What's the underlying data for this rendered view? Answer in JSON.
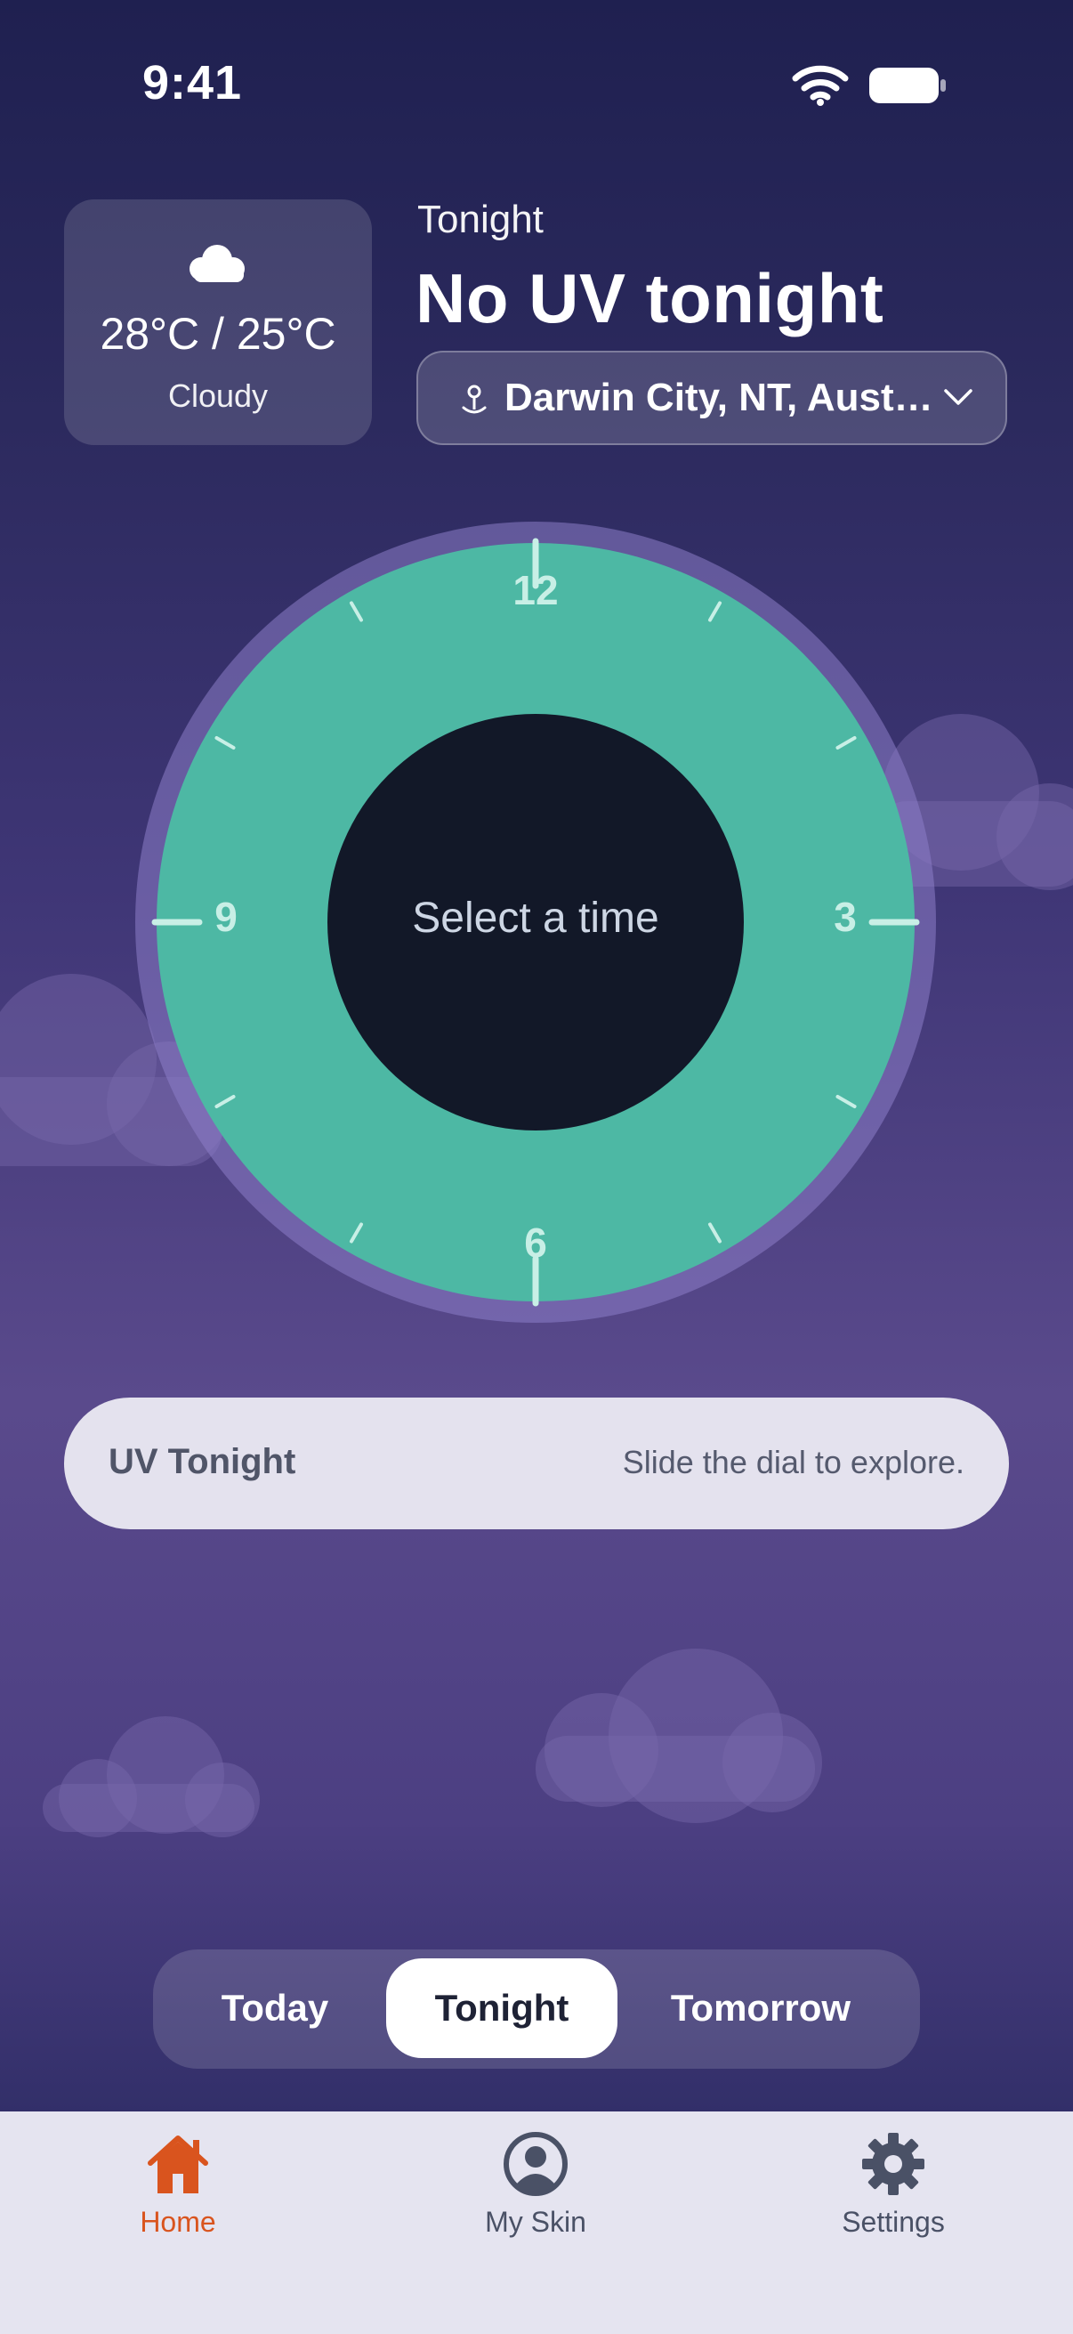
{
  "status_bar": {
    "time": "9:41"
  },
  "weather": {
    "temperature": "28°C / 25°C",
    "condition": "Cloudy",
    "icon": "cloud-icon"
  },
  "header": {
    "subtitle": "Tonight",
    "headline": "No UV tonight"
  },
  "location": {
    "label": "Darwin City, NT, Aust…"
  },
  "dial": {
    "hour_labels": [
      "12",
      "3",
      "6",
      "9"
    ],
    "center_text": "Select a time",
    "ring_color": "#4db8a4",
    "center_color": "#121828"
  },
  "uv_card": {
    "title": "UV Tonight",
    "hint": "Slide the dial to explore."
  },
  "segmented": {
    "options": [
      "Today",
      "Tonight",
      "Tomorrow"
    ],
    "selected": "Tonight"
  },
  "bottom_nav": {
    "items": [
      {
        "label": "Home",
        "icon": "home-icon",
        "active": true
      },
      {
        "label": "My Skin",
        "icon": "profile-icon",
        "active": false
      },
      {
        "label": "Settings",
        "icon": "gear-icon",
        "active": false
      }
    ],
    "active_color": "#d9541e"
  }
}
